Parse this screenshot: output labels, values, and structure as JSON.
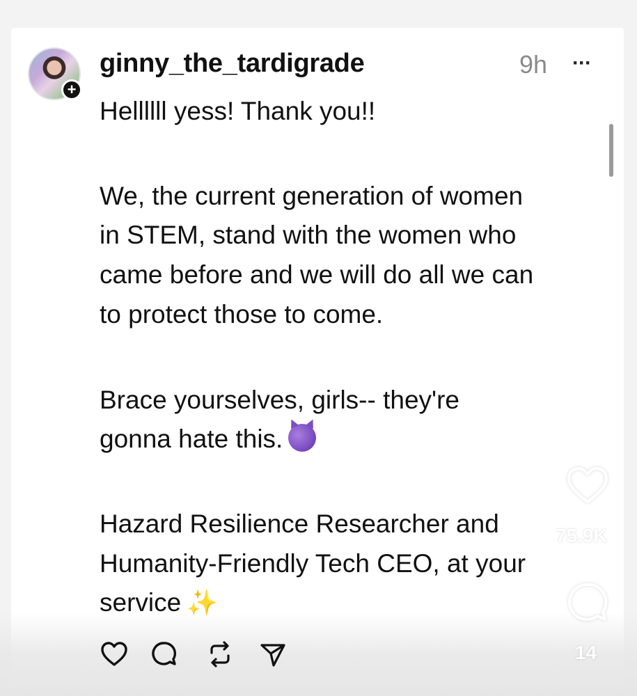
{
  "post": {
    "username": "ginny_the_tardigrade",
    "time": "9h",
    "more_label": "···",
    "add_label": "+",
    "lines": [
      "Hellllll yess! Thank you!!",
      "We, the current generation of women",
      "in STEM, stand with the women who",
      "came before and we will do all we can",
      "to protect those to come.",
      "Brace yourselves, girls-- they're",
      "gonna hate this.",
      "Hazard Resilience Researcher and",
      "Humanity-Friendly Tech CEO, at your",
      "service"
    ],
    "emoji_after_line_7": "smiling-devil",
    "emoji_after_line_10": "sparkles",
    "sparkles_glyph": "✨"
  },
  "actions": {
    "icons": [
      "heart-icon",
      "comment-icon",
      "repost-icon",
      "share-icon"
    ]
  },
  "side_panel": {
    "like_count": "75.9K",
    "comment_count": "14"
  },
  "colors": {
    "text": "#111111",
    "muted": "#8a8a8a",
    "devil_emoji": "#7d4fc2",
    "sparkles": "#f2c84b"
  }
}
